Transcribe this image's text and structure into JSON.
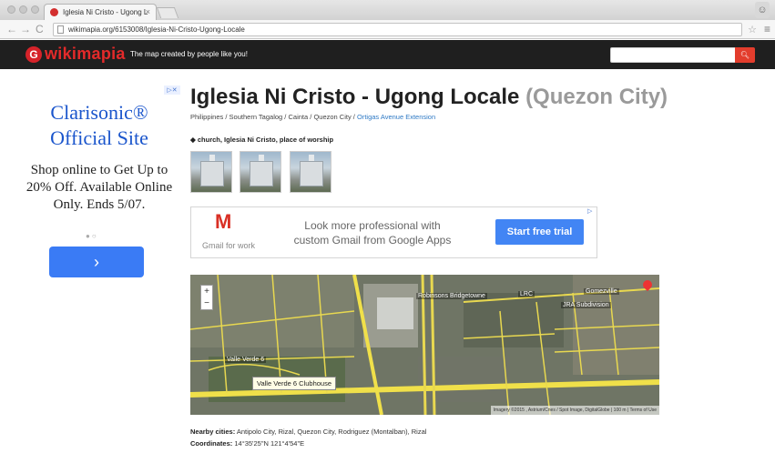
{
  "browser": {
    "tab_title": "Iglesia Ni Cristo - Ugong L",
    "url": "wikimapia.org/6153008/Iglesia-Ni-Cristo-Ugong-Locale"
  },
  "site": {
    "logo": "wikimapia",
    "tagline": "The map created by people like you!",
    "search_placeholder": ""
  },
  "ad_left": {
    "title": "Clarisonic® Official Site",
    "body": "Shop online to Get Up to 20% Off. Available Online Only. Ends 5/07.",
    "button_label": "›"
  },
  "place": {
    "title": "Iglesia Ni Cristo - Ugong Locale",
    "city": "(Quezon City)",
    "breadcrumb": [
      "Philippines",
      "Southern Tagalog",
      "Cainta",
      "Quezon City"
    ],
    "breadcrumb_link": "Ortigas Avenue Extension",
    "tags": "church, Iglesia Ni Cristo, place of worship"
  },
  "ad_gmail": {
    "sub": "Gmail for work",
    "text": "Look more professional with custom Gmail from Google Apps",
    "button_label": "Start free trial"
  },
  "map": {
    "labels": [
      "Robinsons Bridgetowne",
      "LRC",
      "Gomezville",
      "JRA Subdivision",
      "Valle Verde 6"
    ],
    "popup": "Valle Verde 6 Clubhouse",
    "copyright": "Imagery ©2015 , Astrium/Cnes / Spot Image, DigitalGlobe | 100 m | Terms of Use"
  },
  "info": {
    "nearby_label": "Nearby cities:",
    "nearby_value": "Antipolo City, Rizal, Quezon City, Rodriguez (Montalban), Rizal",
    "coords_label": "Coordinates:",
    "coords_value": "14°35'25\"N   121°4'54\"E"
  }
}
